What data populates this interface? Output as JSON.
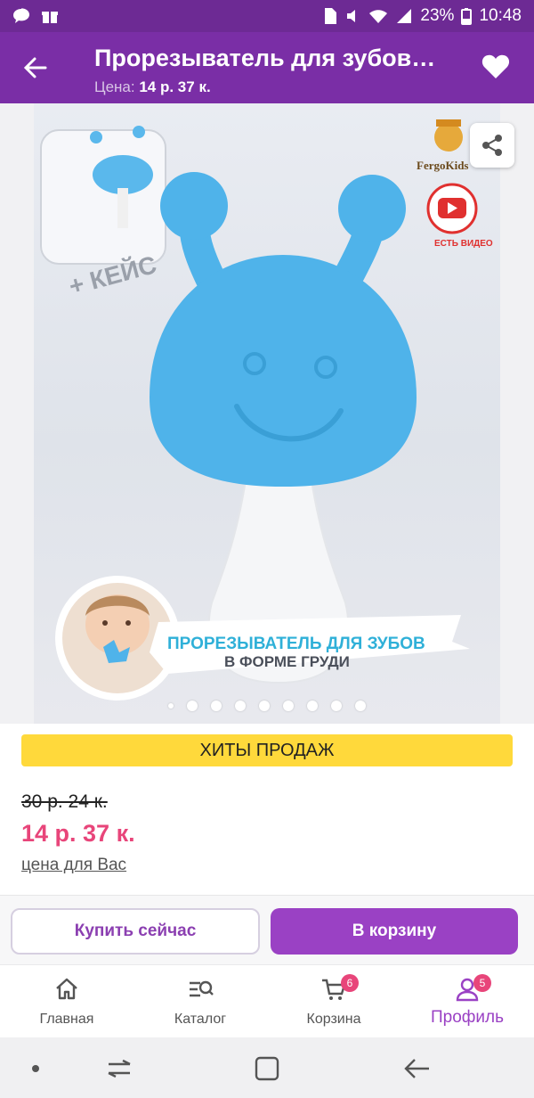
{
  "status": {
    "battery_percent": "23%",
    "time": "10:48"
  },
  "header": {
    "title": "Прорезыватель для зубов…",
    "price_label": "Цена:",
    "price_value": "14 р. 37 к."
  },
  "gallery": {
    "image_text": {
      "case_label": "+ КЕЙС",
      "brand": "FergoKids",
      "video_label": "ЕСТЬ ВИДЕО",
      "banner_line1": "ПРОРЕЗЫВАТЕЛЬ ДЛЯ ЗУБОВ",
      "banner_line2": "В ФОРМЕ ГРУДИ"
    },
    "dots_count": 8,
    "active_dot": 0
  },
  "product": {
    "badge": "ХИТЫ ПРОДАЖ",
    "old_price": "30 р. 24 к.",
    "price": "14 р. 37 к.",
    "price_note": "цена для Вас"
  },
  "actions": {
    "buy_now": "Купить сейчас",
    "add_to_cart": "В корзину"
  },
  "tabs": [
    {
      "label": "Главная",
      "icon": "home-icon"
    },
    {
      "label": "Каталог",
      "icon": "catalog-search-icon"
    },
    {
      "label": "Корзина",
      "icon": "cart-icon",
      "badge": "6"
    },
    {
      "label": "Профиль",
      "icon": "profile-icon",
      "badge": "5",
      "active": true
    }
  ],
  "colors": {
    "brand_purple": "#7a2ea6",
    "button_purple": "#9a41c4",
    "price_pink": "#e8457a",
    "hits_yellow": "#ffd93b",
    "toy_blue": "#4fb3ea"
  }
}
